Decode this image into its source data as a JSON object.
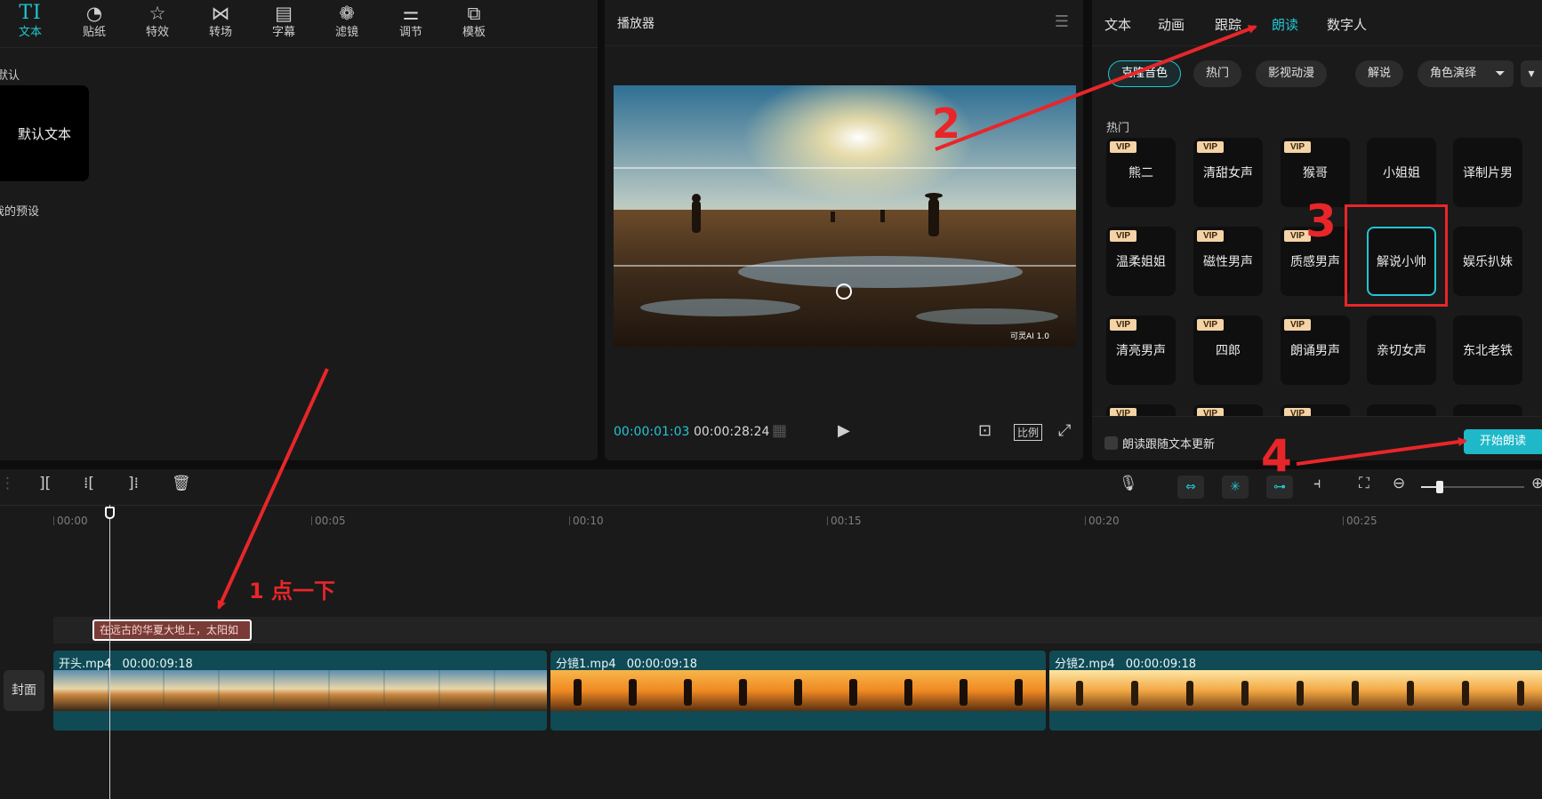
{
  "left_panel": {
    "tools": [
      {
        "label": "文本",
        "icon": "text-tool-icon",
        "glyph": "TI"
      },
      {
        "label": "贴纸",
        "icon": "sticker-icon",
        "glyph": "◔"
      },
      {
        "label": "特效",
        "icon": "effects-star-icon",
        "glyph": "☆"
      },
      {
        "label": "转场",
        "icon": "transition-icon",
        "glyph": "⋈"
      },
      {
        "label": "字幕",
        "icon": "subtitle-icon",
        "glyph": "▤"
      },
      {
        "label": "滤镜",
        "icon": "filter-icon",
        "glyph": "❁"
      },
      {
        "label": "调节",
        "icon": "adjust-sliders-icon",
        "glyph": "⚌"
      },
      {
        "label": "模板",
        "icon": "template-icon",
        "glyph": "⧉"
      }
    ],
    "section_default": "默认",
    "preset_card": "默认文本",
    "section_presets": "我的预设"
  },
  "player": {
    "title": "播放器",
    "time_current": "00:00:01:03",
    "time_total": "00:00:28:24",
    "ratio_label": "比例",
    "watermark": "可灵AI 1.0"
  },
  "right_panel": {
    "tabs": [
      "文本",
      "动画",
      "跟踪",
      "朗读",
      "数字人"
    ],
    "active_tab": "朗读",
    "chips": [
      "克隆音色",
      "热门",
      "影视动漫",
      "解说",
      "角色演绎"
    ],
    "hot_label": "热门",
    "voices": [
      {
        "name": "熊二",
        "vip": true
      },
      {
        "name": "清甜女声",
        "vip": true
      },
      {
        "name": "猴哥",
        "vip": true
      },
      {
        "name": "小姐姐",
        "vip": false
      },
      {
        "name": "译制片男",
        "vip": false
      },
      {
        "name": "温柔姐姐",
        "vip": true
      },
      {
        "name": "磁性男声",
        "vip": true
      },
      {
        "name": "质感男声",
        "vip": true
      },
      {
        "name": "解说小帅",
        "vip": false,
        "selected": true
      },
      {
        "name": "娱乐扒妹",
        "vip": false
      },
      {
        "name": "清亮男声",
        "vip": true
      },
      {
        "name": "四郎",
        "vip": true
      },
      {
        "name": "朗诵男声",
        "vip": true
      },
      {
        "name": "亲切女声",
        "vip": false
      },
      {
        "name": "东北老铁",
        "vip": false
      }
    ],
    "vip_badge": "VIP",
    "checkbox_label": "朗读跟随文本更新",
    "start_button": "开始朗读"
  },
  "timeline": {
    "ruler_ticks": [
      "00:00",
      "00:05",
      "00:10",
      "00:15",
      "00:20",
      "00:25"
    ],
    "text_clip": "在远古的华夏大地上，太阳如",
    "cover_label": "封面",
    "clips": [
      {
        "name": "开头.mp4",
        "duration": "00:00:09:18"
      },
      {
        "name": "分镜1.mp4",
        "duration": "00:00:09:18"
      },
      {
        "name": "分镜2.mp4",
        "duration": "00:00:09:18"
      }
    ],
    "zoom_level": 0.18
  },
  "annotations": {
    "step1": "1 点一下",
    "step2": "2",
    "step3": "3",
    "step4": "4",
    "color": "#e8262a"
  },
  "colors": {
    "accent": "#22c5d3",
    "clip": "#0f4a55",
    "text_clip": "#7a3b36"
  }
}
